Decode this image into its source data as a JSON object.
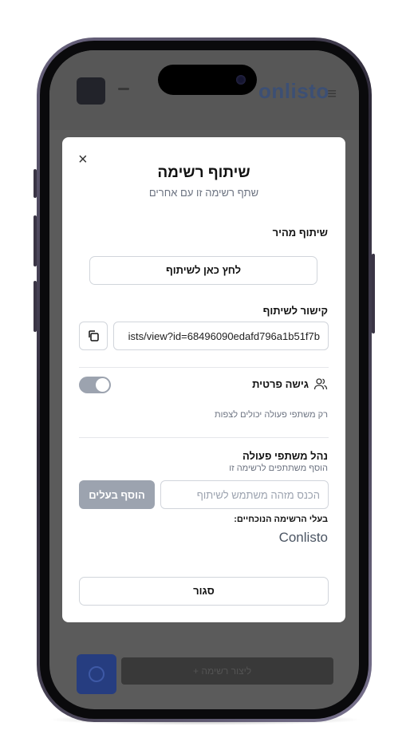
{
  "background_app": {
    "brand": "onlisto",
    "bottom_button": "+ ליצור רשימה"
  },
  "modal": {
    "close_symbol": "×",
    "title": "שיתוף רשימה",
    "subtitle": "שתף רשימה זו עם אחרים",
    "quick_share": {
      "label": "שיתוף מהיר",
      "button": "לחץ כאן לשיתוף"
    },
    "share_link": {
      "label": "קישור לשיתוף",
      "value": "ists/view?id=68496090edafd796a1b51f7b"
    },
    "private_access": {
      "label": "גישה פרטית",
      "hint": "רק משתפי פעולה יכולים לצפות",
      "enabled": false
    },
    "collaborators": {
      "title": "נהל משתפי פעולה",
      "subtitle": "הוסף משתתפים לרשימה זו",
      "input_placeholder": "הכנס מזהה משתמש לשיתוף",
      "add_button": "הוסף בעלים",
      "owners_label": "בעלי הרשימה הנוכחיים:",
      "owners": [
        "Conlisto"
      ]
    },
    "close_button": "סגור"
  },
  "icons": {
    "close": "close-icon",
    "copy": "copy-icon",
    "users": "users-icon"
  },
  "colors": {
    "toggle_off": "#9ca3af",
    "add_button_bg": "#9ca3af",
    "brand_blue": "#3e5177"
  }
}
